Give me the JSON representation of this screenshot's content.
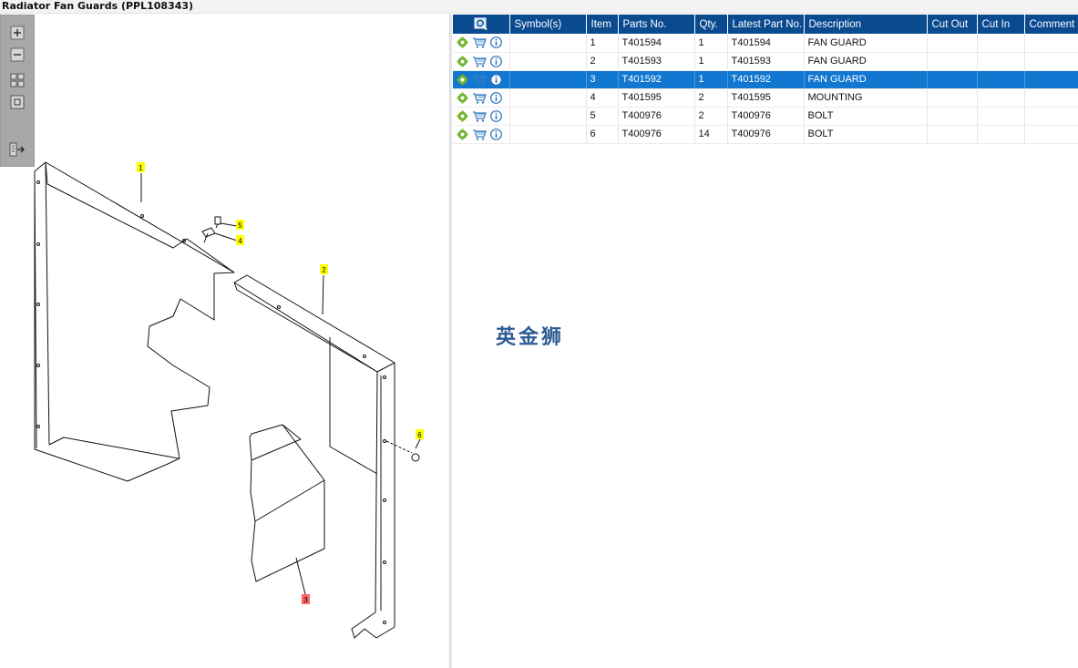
{
  "window": {
    "title": "Radiator Fan Guards (PPL108343)"
  },
  "toolbar": {
    "buttons": [
      {
        "name": "zoom-in",
        "icon": "zoom-in-icon"
      },
      {
        "name": "zoom-out",
        "icon": "zoom-out-icon"
      },
      {
        "name": "fit-all",
        "icon": "fit-all-icon"
      },
      {
        "name": "actual-size",
        "icon": "actual-size-icon"
      },
      {
        "name": "export",
        "icon": "export-icon"
      }
    ]
  },
  "diagram": {
    "callouts": [
      {
        "label": "1",
        "highlight": false
      },
      {
        "label": "2",
        "highlight": false
      },
      {
        "label": "3",
        "highlight": true
      },
      {
        "label": "4",
        "highlight": false
      },
      {
        "label": "5",
        "highlight": false
      },
      {
        "label": "6",
        "highlight": false
      }
    ],
    "callout_color": "#ffff00",
    "callout_highlight_color": "#ff6666"
  },
  "table": {
    "header_icon": "search-parts-icon",
    "columns": [
      "Symbol(s)",
      "Item",
      "Parts No.",
      "Qty.",
      "Latest Part No.",
      "Description",
      "Cut Out",
      "Cut In",
      "Comment"
    ],
    "rows": [
      {
        "item": "1",
        "part_no": "T401594",
        "qty": "1",
        "latest": "T401594",
        "description": "FAN GUARD",
        "selected": false
      },
      {
        "item": "2",
        "part_no": "T401593",
        "qty": "1",
        "latest": "T401593",
        "description": "FAN GUARD",
        "selected": false
      },
      {
        "item": "3",
        "part_no": "T401592",
        "qty": "1",
        "latest": "T401592",
        "description": "FAN GUARD",
        "selected": true
      },
      {
        "item": "4",
        "part_no": "T401595",
        "qty": "2",
        "latest": "T401595",
        "description": "MOUNTING",
        "selected": false
      },
      {
        "item": "5",
        "part_no": "T400976",
        "qty": "2",
        "latest": "T400976",
        "description": "BOLT",
        "selected": false
      },
      {
        "item": "6",
        "part_no": "T400976",
        "qty": "14",
        "latest": "T400976",
        "description": "BOLT",
        "selected": false
      }
    ],
    "row_icons": [
      "gear-icon",
      "cart-icon",
      "info-icon"
    ],
    "header_color": "#0a4a8f",
    "selected_color": "#1177d1"
  },
  "watermark": {
    "text": "英金狮"
  }
}
